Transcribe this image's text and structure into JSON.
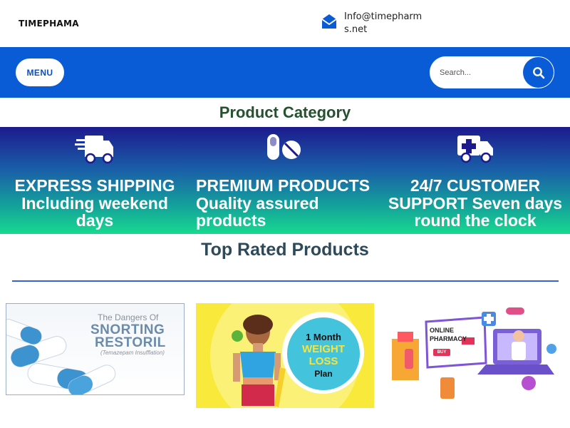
{
  "header": {
    "logo": "TIMEPHAMA",
    "contact_email": "Info@timepharms.net",
    "mail_icon": "envelope-icon"
  },
  "navbar": {
    "menu_label": "MENU",
    "search_placeholder": "Search...",
    "search_icon": "search-icon",
    "color": "#0a5bd6"
  },
  "category": {
    "title": "Product Category",
    "features": [
      {
        "icon": "truck-fast-icon",
        "text": "EXPRESS SHIPPING Including weekend days"
      },
      {
        "icon": "pills-icon",
        "text": "PREMIUM PRODUCTS Quality assured products"
      },
      {
        "icon": "ambulance-icon",
        "text": "24/7 CUSTOMER SUPPORT Seven days round the clock"
      }
    ]
  },
  "top_rated": {
    "title": "Top Rated Products",
    "products": [
      {
        "line1": "The Dangers Of",
        "line2": "SNORTING",
        "line3": "RESTORIL",
        "line4": "(Temazepam Insufflation)"
      },
      {
        "line1": "1 Month",
        "line2": "WEIGHT",
        "line3": "LOSS",
        "line4": "Plan"
      },
      {
        "line1": "ONLINE",
        "line2": "PHARMACY",
        "button": "BUY"
      }
    ]
  }
}
